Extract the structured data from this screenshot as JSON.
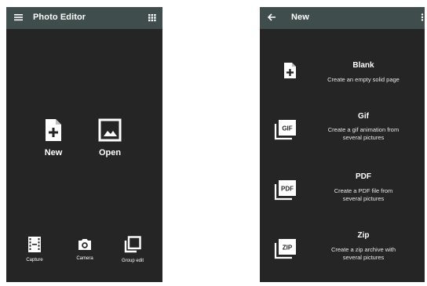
{
  "left_screen": {
    "title": "Photo Editor",
    "menu_icon": "menu-icon",
    "grid_icon": "grid-icon",
    "actions": [
      {
        "label": "New",
        "icon": "new-file-icon"
      },
      {
        "label": "Open",
        "icon": "image-icon"
      }
    ],
    "bottom_actions": [
      {
        "label": "Capture",
        "icon": "film-icon"
      },
      {
        "label": "Camera",
        "icon": "camera-icon"
      },
      {
        "label": "Group edit",
        "icon": "layers-icon"
      }
    ]
  },
  "right_screen": {
    "title": "New",
    "back_icon": "back-arrow-icon",
    "more_icon": "more-vert-icon",
    "options": [
      {
        "title": "Blank",
        "description": "Create an empty solid page",
        "icon": "new-file-icon"
      },
      {
        "title": "Gif",
        "description": "Create a gif animation  from\nseveral pictures",
        "icon_label": "GIF"
      },
      {
        "title": "PDF",
        "description": "Create a PDF file  from\nseveral pictures",
        "icon_label": "PDF"
      },
      {
        "title": "Zip",
        "description": "Create a zip archive  with\nseveral pictures",
        "icon_label": "ZIP"
      }
    ]
  },
  "colors": {
    "app_bar": "#3f4e4c",
    "background": "#252525",
    "text": "#ffffff"
  }
}
